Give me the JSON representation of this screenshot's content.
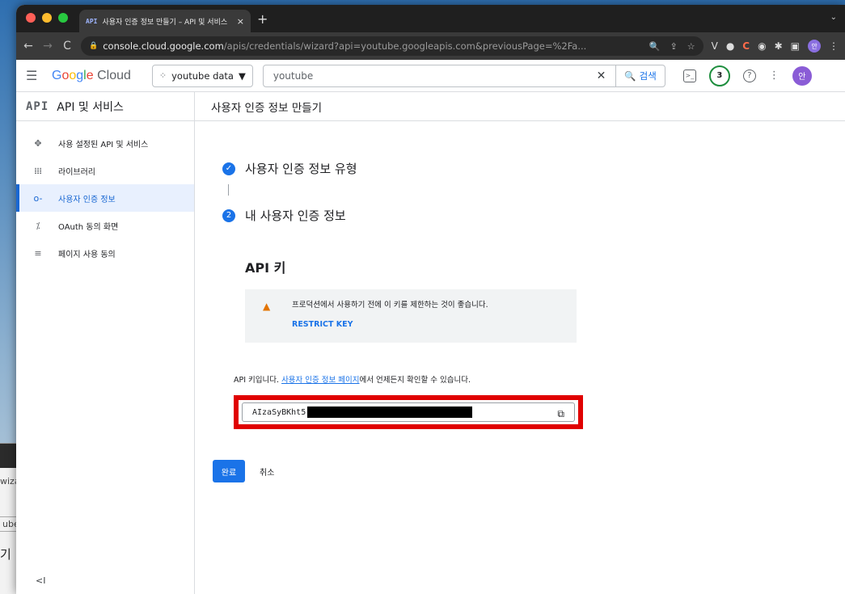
{
  "browser": {
    "tab_favicon": "API",
    "tab_title": "사용자 인증 정보 만들기 – API 및 서비스",
    "tab_close": "×",
    "new_tab": "+",
    "url_host": "console.cloud.google.com",
    "url_path": "/apis/credentials/wizard?api=youtube.googleapis.com&previousPage=%2Fa...",
    "profile_initial": "안"
  },
  "header": {
    "product": "Google Cloud",
    "project_name": "youtube data",
    "search_value": "youtube",
    "search_button": "검색",
    "notifications": "3",
    "avatar": "안"
  },
  "sidebar": {
    "title_icon": "API",
    "title": "API 및 서비스",
    "items": [
      {
        "label": "사용 설정된 API 및 서비스",
        "icon": "enabled-apis-icon"
      },
      {
        "label": "라이브러리",
        "icon": "library-icon"
      },
      {
        "label": "사용자 인증 정보",
        "icon": "key-icon"
      },
      {
        "label": "OAuth 동의 화면",
        "icon": "oauth-icon"
      },
      {
        "label": "페이지 사용 동의",
        "icon": "settings-list-icon"
      }
    ],
    "active_index": 2
  },
  "content": {
    "page_title": "사용자 인증 정보 만들기",
    "step1_label": "사용자 인증 정보 유형",
    "step2_number": "2",
    "step2_label": "내 사용자 인증 정보",
    "apikey_heading": "API 키",
    "warning_text": "프로덕션에서 사용하기 전에 이 키를 제한하는 것이 좋습니다.",
    "restrict_link": "RESTRICT KEY",
    "info_prefix": "API 키입니다. ",
    "info_link": "사용자 인증 정보 페이지",
    "info_suffix": "에서 언제든지 확인할 수 있습니다.",
    "key_visible": "AIzaSyBKht5",
    "done_button": "완료",
    "cancel_button": "취소"
  },
  "colors": {
    "accent": "#1a73e8",
    "highlight_border": "#e00000",
    "warning": "#e37400"
  }
}
